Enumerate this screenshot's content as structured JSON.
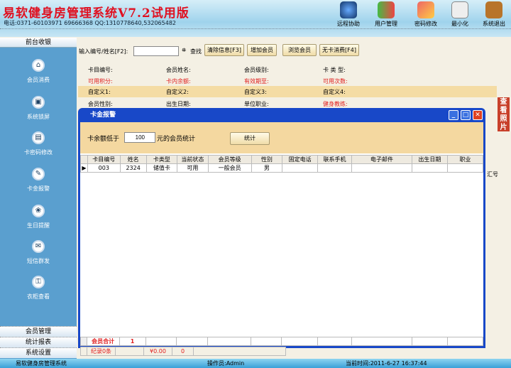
{
  "header": {
    "title": "易软健身房管理系统V7.2试用版",
    "phone": "电话:0371-60103971 69666368 QQ:1310778640,532065482",
    "tools": [
      {
        "label": "远程协助",
        "icon": "remote-help-icon"
      },
      {
        "label": "用户管理",
        "icon": "users-icon"
      },
      {
        "label": "密码修改",
        "icon": "password-icon"
      },
      {
        "label": "最小化",
        "icon": "minimize-icon"
      },
      {
        "label": "系统退出",
        "icon": "exit-icon"
      }
    ]
  },
  "sidebar": {
    "head": "前台收银",
    "items": [
      "会员消费",
      "系统锁屏",
      "卡密码修改",
      "卡金报警",
      "生日提醒",
      "短信群发",
      "衣柜查看"
    ],
    "bottom": [
      "会员管理",
      "统计报表",
      "系统设置"
    ]
  },
  "toolbar": {
    "search_label": "输入编号/姓名[F2]:",
    "search_value": "",
    "find": "查找",
    "clear": "清除信息[F3]",
    "add": "增加会员",
    "browse": "浏览会员",
    "nocard": "无卡消费[F4]"
  },
  "info": {
    "rows": [
      [
        "卡目编号:",
        "会员姓名:",
        "会员级别:",
        "卡 类 型:"
      ],
      [
        "可用积分:",
        "卡内余额:",
        "有效期至:",
        "可用次数:"
      ],
      [
        "自定义1:",
        "自定义2:",
        "自定义3:",
        "自定义4:"
      ],
      [
        "会员性别:",
        "出生日期:",
        "单位职业:",
        "健身教练:"
      ]
    ]
  },
  "side_photo": "查看照片",
  "partial_col": "汇号",
  "dialog": {
    "title": "卡金报警",
    "prefix": "卡余额低于",
    "threshold": "100",
    "suffix": "元的会员统计",
    "button": "统计",
    "columns": [
      "卡目编号",
      "姓名",
      "卡类型",
      "当前状态",
      "会员等级",
      "性别",
      "固定电话",
      "联系手机",
      "电子邮件",
      "出生日期",
      "职业"
    ],
    "rows": [
      [
        "003",
        "2324",
        "储值卡",
        "可用",
        "一般会员",
        "男",
        "",
        "",
        "",
        "",
        ""
      ]
    ],
    "footer_label": "会员合计",
    "footer_count": "1"
  },
  "bottom_row": {
    "records": "纪录0条",
    "amount": "¥0.00",
    "count": "0"
  },
  "status": {
    "app": "易软健身房管理系统",
    "operator": "操作员:Admin",
    "time": "当前时间:2011-6-27 16:37:44"
  }
}
